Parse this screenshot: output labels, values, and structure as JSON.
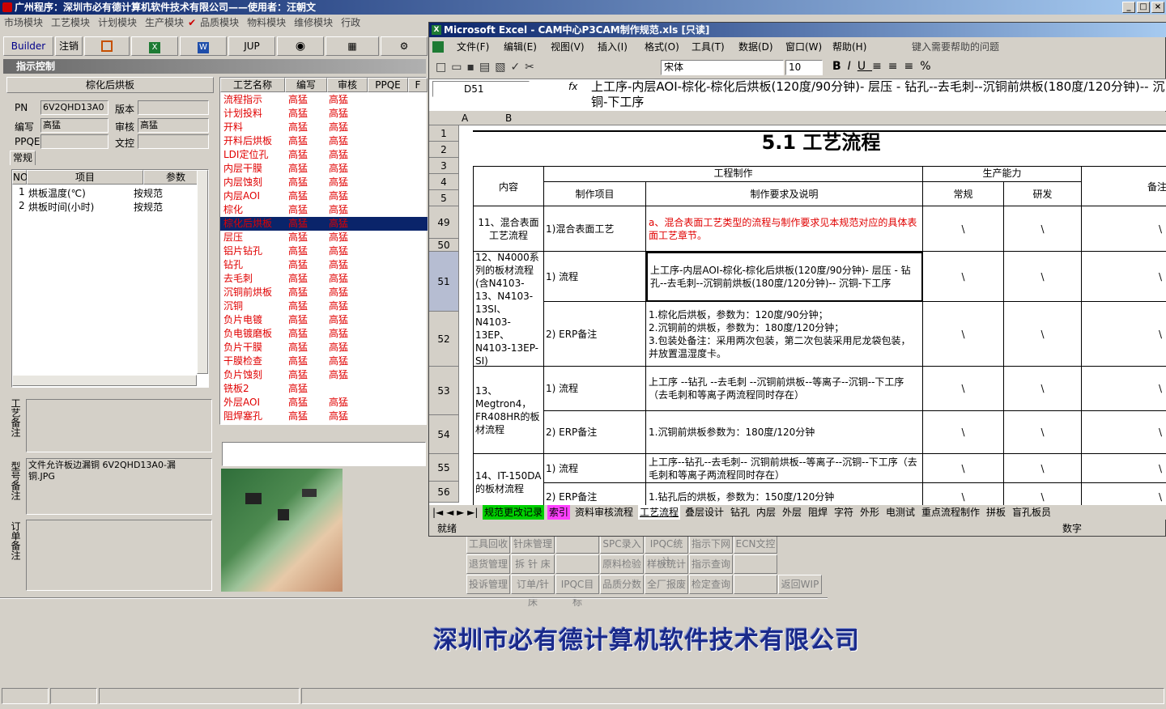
{
  "app": {
    "title": "广州程序：深圳市必有德计算机软件技术有限公司——使用者：汪朝文",
    "menu": [
      "市场模块",
      "工艺模块",
      "计划模块",
      "生产模块",
      "品质模块",
      "物料模块",
      "维修模块",
      "行政"
    ],
    "toolbar": {
      "builder": "Builder",
      "logout": "注销",
      "jup": "JUP"
    },
    "section_title": "指示控制"
  },
  "left": {
    "step_name": "棕化后烘板",
    "pn_label": "PN",
    "pn_value": "6V2QHD13A0",
    "version_label": "版本",
    "version_value": "",
    "editor_label": "编写",
    "editor_value": "高猛",
    "reviewer_label": "审核",
    "reviewer_value": "高猛",
    "ppqe_label": "PPQE",
    "ppqe_value": "",
    "docref_label": "文控",
    "docref_value": "",
    "tab": "常规",
    "param_headers": [
      "NO",
      "项目",
      "参数"
    ],
    "params": [
      {
        "no": "1",
        "item": "烘板温度(℃)",
        "value": "按规范"
      },
      {
        "no": "2",
        "item": "烘板时间(小时)",
        "value": "按规范"
      }
    ],
    "note_labels": [
      "工艺备注",
      "型号备注",
      "订单备注"
    ],
    "model_note": "文件允许板边漏铜 6V2QHD13A0-漏铜.JPG"
  },
  "process": {
    "headers": [
      "工艺名称",
      "编写",
      "审核",
      "PPQE",
      "F"
    ],
    "rows": [
      [
        "流程指示",
        "高猛",
        "高猛"
      ],
      [
        "计划投料",
        "高猛",
        "高猛"
      ],
      [
        "开料",
        "高猛",
        "高猛"
      ],
      [
        "开料后烘板",
        "高猛",
        "高猛"
      ],
      [
        "LDI定位孔",
        "高猛",
        "高猛"
      ],
      [
        "内层干膜",
        "高猛",
        "高猛"
      ],
      [
        "内层蚀刻",
        "高猛",
        "高猛"
      ],
      [
        "内层AOI",
        "高猛",
        "高猛"
      ],
      [
        "棕化",
        "高猛",
        "高猛"
      ],
      [
        "棕化后烘板",
        "高猛",
        "高猛"
      ],
      [
        "层压",
        "高猛",
        "高猛"
      ],
      [
        "铝片钻孔",
        "高猛",
        "高猛"
      ],
      [
        "钻孔",
        "高猛",
        "高猛"
      ],
      [
        "去毛刺",
        "高猛",
        "高猛"
      ],
      [
        "沉铜前烘板",
        "高猛",
        "高猛"
      ],
      [
        "沉铜",
        "高猛",
        "高猛"
      ],
      [
        "负片电镀",
        "高猛",
        "高猛"
      ],
      [
        "负电镀磨板",
        "高猛",
        "高猛"
      ],
      [
        "负片干膜",
        "高猛",
        "高猛"
      ],
      [
        "干膜检查",
        "高猛",
        "高猛"
      ],
      [
        "负片蚀刻",
        "高猛",
        "高猛"
      ],
      [
        "铣板2",
        "高猛",
        ""
      ],
      [
        "外层AOI",
        "高猛",
        "高猛"
      ],
      [
        "阻焊塞孔",
        "高猛",
        "高猛"
      ]
    ],
    "selected_index": 9
  },
  "buttons": [
    [
      "工具回收",
      "针床管理",
      "",
      "SPC录入",
      "IPQC统计",
      "指示下网",
      "ECN文控"
    ],
    [
      "退货管理",
      "拆 针 床",
      "",
      "原料检验",
      "样板统计",
      "指示查询",
      ""
    ],
    [
      "投诉管理",
      "订单/针床",
      "IPQC目标",
      "品质分数",
      "全厂报废",
      "检定查询",
      "",
      "返回WIP"
    ]
  ],
  "company": "深圳市必有德计算机软件技术有限公司",
  "excel": {
    "title": "Microsoft Excel - CAM中心P3CAM制作规范.xls [只读]",
    "menu": [
      "文件(F)",
      "编辑(E)",
      "视图(V)",
      "插入(I)",
      "格式(O)",
      "工具(T)",
      "数据(D)",
      "窗口(W)",
      "帮助(H)"
    ],
    "help_placeholder": "键入需要帮助的问题",
    "font": "宋体",
    "size": "10",
    "name_box": "D51",
    "formula": "上工序-内层AOI-棕化-棕化后烘板(120度/90分钟)- 层压 - 钻孔--去毛刺--沉铜前烘板(180度/120分钟)-- 沉铜-下工序",
    "cols": [
      "A",
      "B"
    ],
    "sheet_title": "5.1 工艺流程",
    "h_content": "内容",
    "h_eng": "工程制作",
    "h_cap": "生产能力",
    "h_note": "备注",
    "h_item": "制作项目",
    "h_req": "制作要求及说明",
    "h_normal": "常规",
    "h_rd": "研发",
    "rows": [
      {
        "row": "49",
        "content": "11、混合表面工艺流程",
        "item": "1)混合表面工艺",
        "req": "a、混合表面工艺类型的流程与制作要求见本规范对应的具体表面工艺章节。",
        "n": "\\",
        "r": "\\",
        "note": "\\"
      },
      {
        "row": "51",
        "content": "12、N4000系列的板材流程(含N4103-13、N4103-13SI、N4103-13EP、N4103-13EP-SI)",
        "item": "1) 流程",
        "req": "上工序-内层AOI-棕化-棕化后烘板(120度/90分钟)- 层压 - 钻孔--去毛刺--沉铜前烘板(180度/120分钟)-- 沉铜-下工序",
        "n": "\\",
        "r": "\\",
        "note": "\\"
      },
      {
        "row": "52",
        "item": "2) ERP备注",
        "req": "1.棕化后烘板，参数为：120度/90分钟；\n2.沉铜前的烘板，参数为：180度/120分钟；\n3.包装处备注：采用两次包装，第二次包装采用尼龙袋包装，并放置温湿度卡。",
        "n": "\\",
        "r": "\\",
        "note": "\\"
      },
      {
        "row": "53",
        "content": "13、Megtron4，FR408HR的板材流程",
        "item": "1) 流程",
        "req": "上工序 --钻孔 --去毛刺 --沉铜前烘板--等离子--沉铜--下工序（去毛刺和等离子两流程同时存在）",
        "n": "\\",
        "r": "\\",
        "note": "\\"
      },
      {
        "row": "54",
        "item": "2) ERP备注",
        "req": "1.沉铜前烘板参数为：180度/120分钟",
        "n": "\\",
        "r": "\\",
        "note": "\\"
      },
      {
        "row": "55",
        "content": "14、IT-150DA的板材流程",
        "item": "1) 流程",
        "req": "上工序--钻孔--去毛刺-- 沉铜前烘板--等离子--沉铜--下工序（去毛刺和等离子两流程同时存在）",
        "n": "\\",
        "r": "\\",
        "note": "\\"
      },
      {
        "row": "56",
        "item": "2) ERP备注",
        "req": "1.钻孔后的烘板，参数为：150度/120分钟",
        "n": "\\",
        "r": "\\",
        "note": "\\"
      }
    ],
    "row_nums": [
      "1",
      "2",
      "3",
      "4",
      "5",
      "49",
      "50",
      "51",
      "52",
      "53",
      "54",
      "55",
      "56"
    ],
    "tabs": [
      "规范更改记录",
      "索引",
      "资料审核流程",
      "工艺流程",
      "叠层设计",
      "钻孔",
      "内层",
      "外层",
      "阻焊",
      "字符",
      "外形",
      "电测试",
      "重点流程制作",
      "拼板",
      "盲孔板员"
    ],
    "status_left": "就绪",
    "status_right": "数字"
  }
}
